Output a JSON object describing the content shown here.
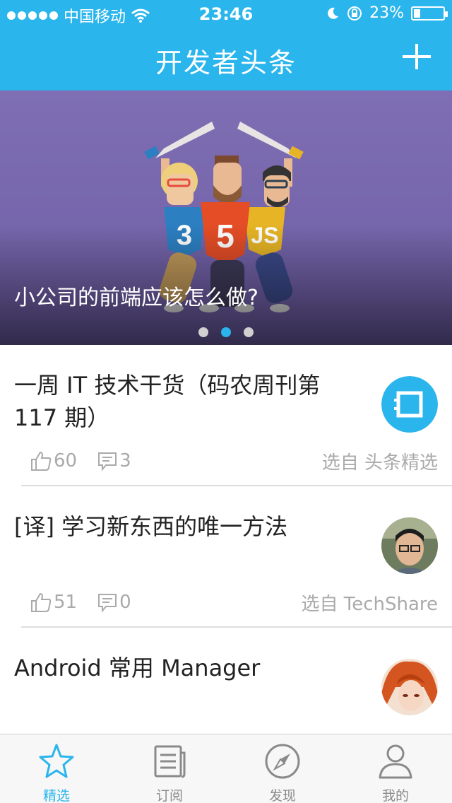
{
  "status": {
    "carrier": "中国移动",
    "time": "23:46",
    "battery": "23%",
    "battery_level": 0.23
  },
  "nav": {
    "title": "开发者头条"
  },
  "banner": {
    "caption": "小公司的前端应该怎么做?",
    "pages": 3,
    "active_page": 2,
    "badges": [
      "3",
      "5",
      "JS"
    ]
  },
  "articles": [
    {
      "title": "一周 IT 技术干货（码农周刊第 117 期）",
      "likes": "60",
      "comments": "3",
      "source": "选自 头条精选"
    },
    {
      "title": "[译] 学习新东西的唯一方法",
      "likes": "51",
      "comments": "0",
      "source": "选自 TechShare"
    },
    {
      "title": "Android 常用 Manager",
      "likes": "",
      "comments": "",
      "source": ""
    }
  ],
  "tabs": [
    {
      "label": "精选",
      "icon": "star-icon",
      "active": true
    },
    {
      "label": "订阅",
      "icon": "list-icon",
      "active": false
    },
    {
      "label": "发现",
      "icon": "compass-icon",
      "active": false
    },
    {
      "label": "我的",
      "icon": "user-icon",
      "active": false
    }
  ],
  "colors": {
    "accent": "#2ab5ec",
    "banner": "#7f6eb3",
    "muted": "#aaaaaa"
  }
}
